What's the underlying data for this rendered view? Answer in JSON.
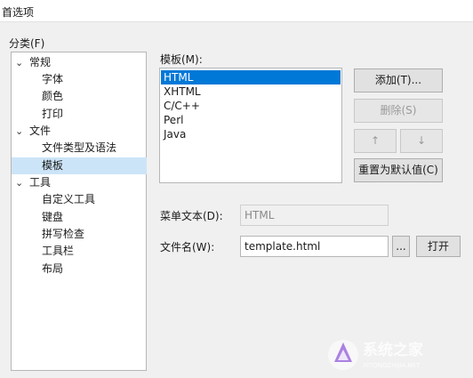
{
  "window": {
    "title": "首选项"
  },
  "category_label": "分类(F)",
  "tree": [
    {
      "label": "常规",
      "expanded": true,
      "children": [
        "字体",
        "颜色",
        "打印"
      ]
    },
    {
      "label": "文件",
      "expanded": true,
      "children": [
        "文件类型及语法",
        "模板"
      ]
    },
    {
      "label": "工具",
      "expanded": true,
      "children": [
        "自定义工具",
        "键盘",
        "拼写检查",
        "工具栏",
        "布局"
      ]
    }
  ],
  "tree_selected": "模板",
  "templates": {
    "label": "模板(M):",
    "items": [
      "HTML",
      "XHTML",
      "C/C++",
      "Perl",
      "Java"
    ],
    "selected": "HTML"
  },
  "buttons": {
    "add": "添加(T)...",
    "delete": "删除(S)",
    "up": "↑",
    "down": "↓",
    "reset": "重置为默认值(C)",
    "browse": "...",
    "open": "打开"
  },
  "menu_text": {
    "label": "菜单文本(D):",
    "value": "HTML"
  },
  "file_name": {
    "label": "文件名(W):",
    "value": "template.html"
  },
  "watermark": {
    "brand": "系统之家",
    "url": "XITONGZHIJIA.NET"
  }
}
